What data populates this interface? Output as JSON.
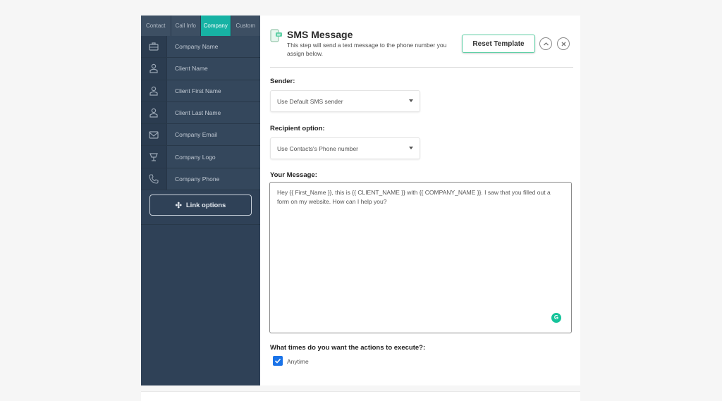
{
  "sidebar": {
    "tabs": [
      {
        "label": "Contact",
        "active": false
      },
      {
        "label": "Call Info",
        "active": false
      },
      {
        "label": "Company",
        "active": true
      },
      {
        "label": "Custom",
        "active": false
      }
    ],
    "fields": [
      {
        "label": "Company Name",
        "icon": "briefcase-icon"
      },
      {
        "label": "Client Name",
        "icon": "person-icon"
      },
      {
        "label": "Client First Name",
        "icon": "person-icon"
      },
      {
        "label": "Client Last Name",
        "icon": "person-icon"
      },
      {
        "label": "Company Email",
        "icon": "envelope-icon"
      },
      {
        "label": "Company Logo",
        "icon": "logo-icon"
      },
      {
        "label": "Company Phone",
        "icon": "phone-icon"
      }
    ],
    "link_options_label": "Link options"
  },
  "header": {
    "title": "SMS Message",
    "subtitle": "This step will send a text message to the phone number you assign below.",
    "reset_label": "Reset Template"
  },
  "form": {
    "sender_label": "Sender:",
    "sender_value": "Use Default SMS sender",
    "recipient_label": "Recipient option:",
    "recipient_value": "Use Contacts's Phone number",
    "message_label": "Your Message:",
    "message_text": "Hey {{ First_Name }}, this is {{ CLIENT_NAME }} with {{ COMPANY_NAME }}. I saw that you filled out a form on my website. How can I help you?",
    "times_label": "What times do you want the actions to execute?:",
    "anytime_label": "Anytime",
    "anytime_checked": true
  },
  "colors": {
    "sidebar_bg": "#2f4157",
    "tab_active": "#17b2a4",
    "reset_border": "#5fd0a6",
    "checkbox": "#1a73e8"
  }
}
